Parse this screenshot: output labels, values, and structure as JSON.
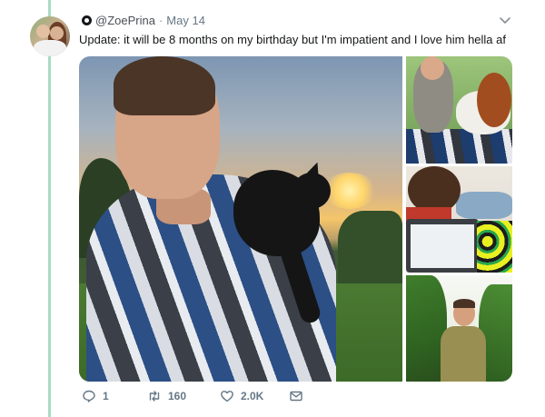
{
  "tweet": {
    "handle": "@ZoePrina",
    "separator": "·",
    "date": "May 14",
    "text": "Update: it will be 8 months on my birthday but I'm impatient and I love him hella af"
  },
  "actions": {
    "reply_count": "1",
    "retweet_count": "160",
    "like_count": "2.0K"
  },
  "colors": {
    "thread_line": "#a8dcc4",
    "action_gray": "#657786"
  },
  "icons": [
    "verified-badge-icon",
    "chevron-down-icon",
    "reply-icon",
    "retweet-icon",
    "like-icon",
    "direct-message-icon"
  ]
}
